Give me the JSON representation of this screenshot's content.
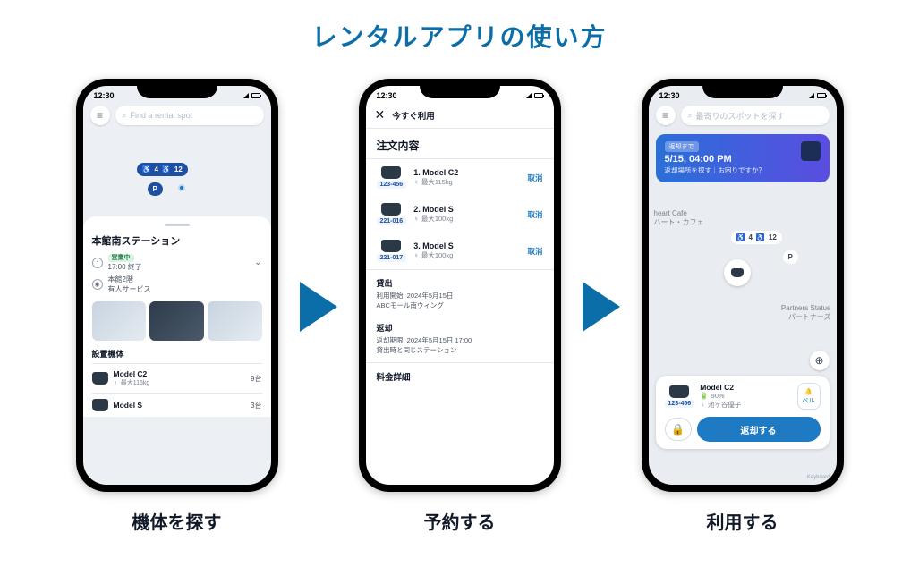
{
  "title": "レンタルアプリの使い方",
  "captions": [
    "機体を探す",
    "予約する",
    "利用する"
  ],
  "status": {
    "time": "12:30"
  },
  "screen1": {
    "search_placeholder": "Find a rental spot",
    "map_pills": {
      "scooter": "4",
      "wheelchair": "12",
      "p": "P"
    },
    "station_name": "本館南ステーション",
    "status_badge": "営業中",
    "hours": "17:00 終了",
    "loc_line1": "本館2階",
    "loc_line2": "有人サービス",
    "section": "設置機体",
    "models": [
      {
        "name": "Model C2",
        "spec": "最大115kg",
        "count": "9台"
      },
      {
        "name": "Model S",
        "spec": "",
        "count": "3台"
      }
    ]
  },
  "screen2": {
    "header": "今すぐ利用",
    "title": "注文内容",
    "items": [
      {
        "code": "123-456",
        "label": "1. Model C2",
        "spec": "最大115kg",
        "action": "取消"
      },
      {
        "code": "221-016",
        "label": "2. Model S",
        "spec": "最大100kg",
        "action": "取消"
      },
      {
        "code": "221-017",
        "label": "3. Model S",
        "spec": "最大100kg",
        "action": "取消"
      }
    ],
    "lend": {
      "h": "貸出",
      "l1": "利用開始: 2024年5月15日",
      "l2": "ABCモール南ウィング"
    },
    "ret": {
      "h": "返却",
      "l1": "返却期限: 2024年5月15日 17:00",
      "l2": "貸出時と同じステーション"
    },
    "fee_h": "料金詳細"
  },
  "screen3": {
    "search_placeholder": "最寄りのスポットを探す",
    "banner": {
      "tag": "返却まで",
      "dt": "5/15, 04:00 PM",
      "q": "返却場所を探す｜お困りですか？"
    },
    "map_labels": {
      "cafe": "heart Cafe\nハート・カフェ",
      "partners": "Partners Statue\nパートナーズ"
    },
    "pills": {
      "scooter": "4",
      "wheelchair": "12",
      "p": "P"
    },
    "card": {
      "code": "123-456",
      "name": "Model C2",
      "battery": "90%",
      "user": "池ヶ谷優子",
      "bell": "ベル",
      "return": "返却する"
    },
    "kb": "Keyboard"
  }
}
